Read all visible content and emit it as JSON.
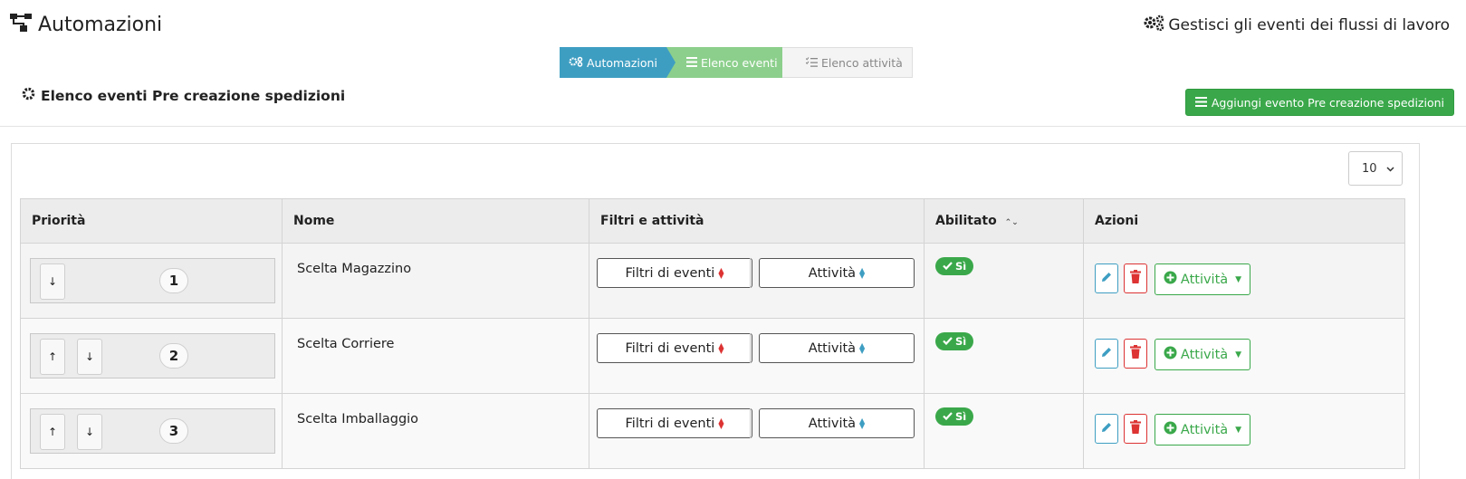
{
  "header": {
    "title": "Automazioni",
    "right_text": "Gestisci gli eventi dei flussi di lavoro"
  },
  "stepper": {
    "steps": [
      {
        "label": "Automazioni",
        "state": "done",
        "color": "#3e9ec2"
      },
      {
        "label": "Elenco eventi",
        "state": "active",
        "color": "#8ccf8c"
      },
      {
        "label": "Elenco attività",
        "state": "pending",
        "color": "#f4f4f4"
      }
    ]
  },
  "section": {
    "title": "Elenco eventi Pre creazione spedizioni",
    "add_button": "Aggiungi evento Pre creazione spedizioni"
  },
  "table": {
    "page_size": "10",
    "columns": [
      "Priorità",
      "Nome",
      "Filtri e attività",
      "Abilitato",
      "Azioni"
    ],
    "sortable_column": "Abilitato",
    "rows": [
      {
        "priority": "1",
        "name": "Scelta Magazzino",
        "filters_label": "Filtri di eventi",
        "activities_label": "Attività",
        "enabled": "Sì",
        "more_label": "Attività",
        "has_up": false,
        "has_down": true
      },
      {
        "priority": "2",
        "name": "Scelta Corriere",
        "filters_label": "Filtri di eventi",
        "activities_label": "Attività",
        "enabled": "Sì",
        "more_label": "Attività",
        "has_up": true,
        "has_down": true
      },
      {
        "priority": "3",
        "name": "Scelta Imballaggio",
        "filters_label": "Filtri di eventi",
        "activities_label": "Attività",
        "enabled": "Sì",
        "more_label": "Attività",
        "has_up": true,
        "has_down": true
      }
    ]
  },
  "colors": {
    "primary": "#3e9ec2",
    "success": "#3aa84a",
    "danger": "#d33333",
    "active_step": "#8ccf8c"
  },
  "icons": {
    "app": "sitemap-icon",
    "header_right": "gears-icon",
    "section": "gear-icon",
    "add": "list-icon",
    "edit": "pencil-icon",
    "delete": "trash-icon",
    "more": "plus-circle-icon"
  }
}
